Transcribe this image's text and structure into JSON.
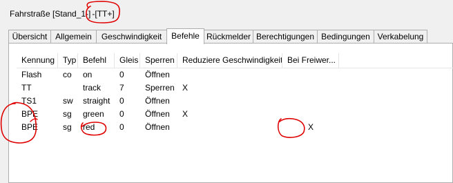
{
  "window": {
    "title_prefix": "Fahrstraße [Stand_1-]",
    "title_suffix": "-[TT+]"
  },
  "tabs": [
    {
      "label": "Übersicht"
    },
    {
      "label": "Allgemein"
    },
    {
      "label": "Geschwindigkeit"
    },
    {
      "label": "Befehle"
    },
    {
      "label": "Rückmelder"
    },
    {
      "label": "Berechtigungen"
    },
    {
      "label": "Bedingungen"
    },
    {
      "label": "Verkabelung"
    }
  ],
  "active_tab": "Befehle",
  "table": {
    "columns": [
      "Kennung",
      "Typ",
      "Befehl",
      "Gleis",
      "Sperren",
      "Reduziere Geschwindigkeit",
      "Bei Freiwer..."
    ],
    "rows": [
      [
        "Flash",
        "co",
        "on",
        "0",
        "Öffnen",
        "",
        ""
      ],
      [
        "TT",
        "",
        "track",
        "7",
        "Sperren",
        "X",
        ""
      ],
      [
        "TS1",
        "sw",
        "straight",
        "0",
        "Öffnen",
        "",
        ""
      ],
      [
        "BPE",
        "sg",
        "green",
        "0",
        "Öffnen",
        "X",
        ""
      ],
      [
        "BPE",
        "sg",
        "red",
        "0",
        "Öffnen",
        "",
        "X"
      ]
    ]
  },
  "annotations": {
    "color": "#e00000"
  }
}
